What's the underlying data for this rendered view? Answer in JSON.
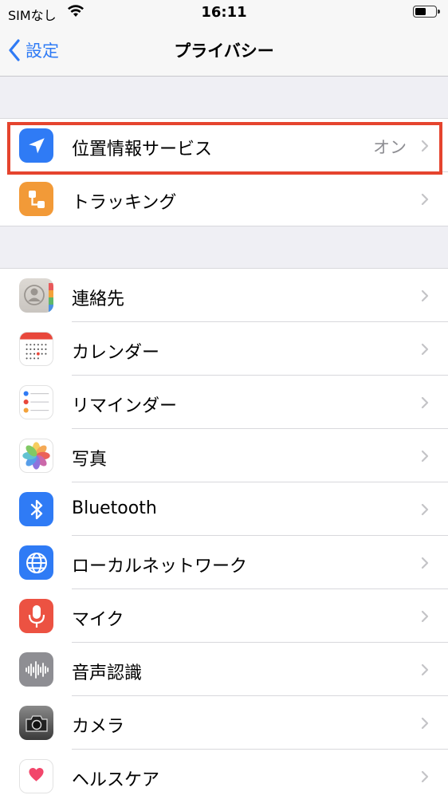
{
  "status_bar": {
    "carrier": "SIMなし",
    "time": "16:11",
    "battery_level": 0.55
  },
  "nav": {
    "back_label": "設定",
    "title": "プライバシー"
  },
  "group1": [
    {
      "label": "位置情報サービス",
      "value": "オン",
      "icon": "location-arrow-icon",
      "color": "#2f7bf5"
    },
    {
      "label": "トラッキング",
      "icon": "tracking-icon",
      "color": "#f29a38"
    }
  ],
  "group2": [
    {
      "label": "連絡先",
      "icon": "contacts-icon"
    },
    {
      "label": "カレンダー",
      "icon": "calendar-icon"
    },
    {
      "label": "リマインダー",
      "icon": "reminders-icon"
    },
    {
      "label": "写真",
      "icon": "photos-icon"
    },
    {
      "label": "Bluetooth",
      "icon": "bluetooth-icon",
      "color": "#2f7bf5"
    },
    {
      "label": "ローカルネットワーク",
      "icon": "globe-icon",
      "color": "#2f7bf5"
    },
    {
      "label": "マイク",
      "icon": "microphone-icon",
      "color": "#ec5242"
    },
    {
      "label": "音声認識",
      "icon": "waveform-icon",
      "color": "#8e8e93"
    },
    {
      "label": "カメラ",
      "icon": "camera-icon",
      "color": "#444444"
    },
    {
      "label": "ヘルスケア",
      "icon": "health-heart-icon",
      "color": "#f2466b"
    }
  ],
  "accent_color": "#2f7bf5",
  "highlight_color": "#e5442e"
}
